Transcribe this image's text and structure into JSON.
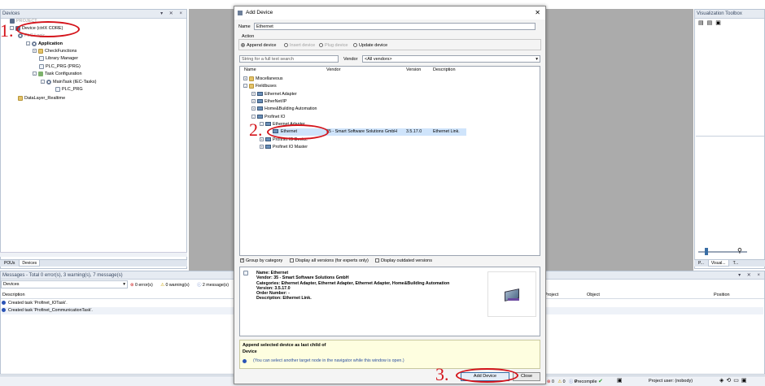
{
  "devices_panel": {
    "title": "Devices",
    "tree": [
      {
        "label": "PROJECT",
        "icon": "project-icon"
      },
      {
        "label": "Device (ctrlX CORE)",
        "icon": "device-icon"
      },
      {
        "label": "PLC Logic",
        "icon": "plc-logic-icon"
      },
      {
        "label": "Application",
        "icon": "application-icon"
      },
      {
        "label": "CheckFunctions",
        "icon": "folder-icon"
      },
      {
        "label": "Library Manager",
        "icon": "library-icon"
      },
      {
        "label": "PLC_PRG (PRG)",
        "icon": "pou-icon"
      },
      {
        "label": "Task Configuration",
        "icon": "task-config-icon"
      },
      {
        "label": "MainTask (IEC-Tasks)",
        "icon": "task-icon"
      },
      {
        "label": "PLC_PRG",
        "icon": "pou-icon"
      },
      {
        "label": "DataLayer_Realtime",
        "icon": "datalayer-icon"
      }
    ],
    "tabs": [
      "POUs",
      "Devices"
    ]
  },
  "toolbox": {
    "title": "Visualization Toolbox",
    "tabs": [
      "P...",
      "Visual...",
      "T..."
    ]
  },
  "dialog": {
    "title": "Add Device",
    "name_label": "Name",
    "name_value": "Ethernet",
    "action_label": "Action",
    "actions": [
      {
        "label": "Append device",
        "selected": true,
        "enabled": true
      },
      {
        "label": "Insert device",
        "selected": false,
        "enabled": false
      },
      {
        "label": "Plug device",
        "selected": false,
        "enabled": false
      },
      {
        "label": "Update device",
        "selected": false,
        "enabled": true
      }
    ],
    "search_placeholder": "String for a full text search",
    "vendor_label": "Vendor",
    "vendor_value": "<All vendors>",
    "columns": [
      "Name",
      "Vendor",
      "Version",
      "Description"
    ],
    "rows": [
      {
        "name": "Miscellaneous",
        "vendor": "",
        "version": "",
        "description": ""
      },
      {
        "name": "Fieldbuses",
        "vendor": "",
        "version": "",
        "description": ""
      },
      {
        "name": "Ethernet Adapter",
        "vendor": "",
        "version": "",
        "description": ""
      },
      {
        "name": "EtherNet/IP",
        "vendor": "",
        "version": "",
        "description": ""
      },
      {
        "name": "Home&Building Automation",
        "vendor": "",
        "version": "",
        "description": ""
      },
      {
        "name": "Profinet IO",
        "vendor": "",
        "version": "",
        "description": ""
      },
      {
        "name": "Ethernet Adapter",
        "vendor": "",
        "version": "",
        "description": ""
      },
      {
        "name": "Ethernet",
        "vendor": "35 - Smart Software Solutions GmbH",
        "version": "3.5.17.0",
        "description": "Ethernet Link."
      },
      {
        "name": "Profinet IO Device",
        "vendor": "",
        "version": "",
        "description": ""
      },
      {
        "name": "Profinet IO Master",
        "vendor": "",
        "version": "",
        "description": ""
      }
    ],
    "options": [
      {
        "label": "Group by category",
        "checked": true
      },
      {
        "label": "Display all versions (for experts only)",
        "checked": false
      },
      {
        "label": "Display outdated versions",
        "checked": false
      }
    ],
    "info": {
      "name": "Name: Ethernet",
      "vendor": "Vendor: 35 - Smart Software Solutions GmbH",
      "categories": "Categories: Ethernet Adapter, Ethernet Adapter, Ethernet Adapter, Home&Building Automation",
      "version": "Version: 3.5.17.0",
      "order": "Order Number: -",
      "description": "Description: Ethernet Link."
    },
    "append_title": "Append selected device as last child of",
    "append_target": "Device",
    "append_hint": "(You can select another target node in the navigator while this window is open.)",
    "add_button": "Add Device",
    "close_button": "Close"
  },
  "messages_panel": {
    "title": "Messages - Total 0 error(s), 3 warning(s), 7 message(s)",
    "filter": "Devices",
    "counts": [
      "0 error(s)",
      "0 warning(s)",
      "2 message(s)"
    ],
    "columns": [
      "Description",
      "Project",
      "Object",
      "Position"
    ],
    "rows": [
      "Created task 'Profinet_IOTask'.",
      "Created task 'Profinet_CommunicationTask'."
    ]
  },
  "status_bar": {
    "counts": [
      "0",
      "0",
      "0"
    ],
    "precompile": "Precompile",
    "user": "Project user: (nobody)"
  },
  "annotations": [
    "1.",
    "2.",
    "3."
  ],
  "colors": {
    "annotation": "#d4141b",
    "selection": "#cfe4fb"
  }
}
